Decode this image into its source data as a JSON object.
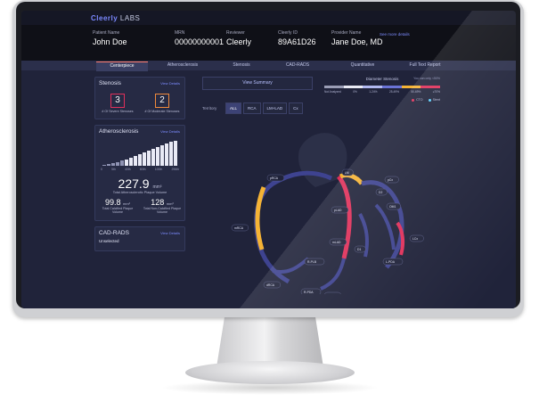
{
  "brand": {
    "name": "Cleerly",
    "suffix": "LABS"
  },
  "patient": {
    "name_label": "Patient Name",
    "name": "John Doe",
    "mrn_label": "MRN",
    "mrn": "00000000001",
    "reviewer_label": "Reviewer",
    "reviewer": "Cleerly",
    "cleerly_id_label": "Cleerly ID",
    "cleerly_id": "89A61D26",
    "provider_label": "Provider Name",
    "provider": "Jane Doe, MD",
    "see_more": "See more details"
  },
  "tabs": [
    "Centerpiece",
    "Atherosclerosis",
    "Stenosis",
    "CAD-RADS",
    "Quantitative",
    "Full Text Report"
  ],
  "stenosis_card": {
    "title": "Stenosis",
    "view_details": "View Details",
    "severe_count": "3",
    "severe_label": "# Of Severe Stenoses",
    "moderate_count": "2",
    "moderate_label": "# Of Moderate Stenoses"
  },
  "athero_card": {
    "title": "Atherosclerosis",
    "view_details": "View Details",
    "axis": [
      "0",
      "5th",
      "40th",
      "80th",
      "100th",
      "296th"
    ],
    "total_value": "227.9",
    "unit": "mm³",
    "total_label": "Total Atherosclerotic Plaque Volume",
    "calcified_value": "99.8",
    "calcified_label": "Total Calcified Plaque Volume",
    "noncalcified_value": "128",
    "noncalcified_label": "Total Non-Calcified Plaque Volume"
  },
  "cadrads_card": {
    "title": "CAD-RADS",
    "view_details": "View Details",
    "value": "Unselected"
  },
  "center": {
    "view_summary": "View Summary",
    "territory_label": "Territory",
    "territories": [
      "ALL",
      "RCA",
      "LM+LAD",
      "Cx"
    ]
  },
  "legend": {
    "title": "Diameter Stenosis",
    "note": "You can only <50%",
    "labels": [
      "Not Analyzed",
      "0%",
      "1-24%",
      "25-49%",
      "50-69%",
      "≥70%"
    ],
    "colors": [
      "#9a9db5",
      "#e9eaf4",
      "#b1b8f0",
      "#6a73d6",
      "#f5b335",
      "#e0305a"
    ],
    "cto": "CTO",
    "stent": "Stent"
  },
  "vessels": [
    "LM",
    "pCx",
    "pRCA",
    "D2",
    "OM1",
    "pLAD",
    "mRCA",
    "mLAD",
    "D1",
    "LCx",
    "R-PLB",
    "dRCA",
    "dLAD",
    "R-PDA",
    "L-PDA"
  ]
}
